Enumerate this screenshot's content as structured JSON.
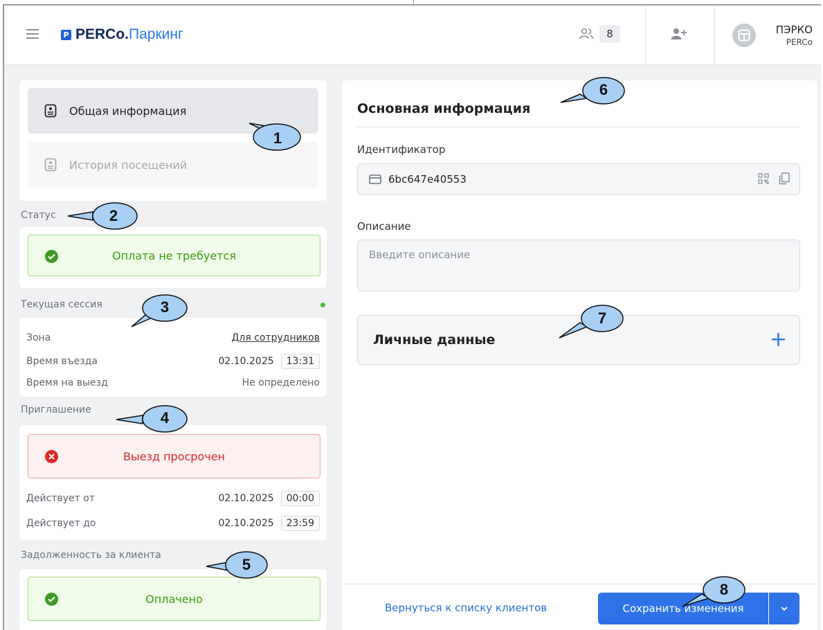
{
  "header": {
    "logo_mark": "P",
    "logo_brand": "PERCo.",
    "logo_app": "Паркинг",
    "users_count": "8",
    "user_name": "ПЭРКО",
    "user_org": "PERCo"
  },
  "nav": {
    "general_info": "Общая информация",
    "visit_history": "История посещений"
  },
  "status": {
    "label": "Статус",
    "text": "Оплата не требуется"
  },
  "session": {
    "label": "Текущая сессия",
    "zone_label": "Зона",
    "zone_value": "Для сотрудников",
    "entry_label": "Время въезда",
    "entry_date": "02.10.2025",
    "entry_time": "13:31",
    "exit_label": "Время на выезд",
    "exit_value": "Не определено"
  },
  "invitation": {
    "label": "Приглашение",
    "alert": "Выезд просрочен",
    "from_label": "Действует от",
    "from_date": "02.10.2025",
    "from_time": "00:00",
    "to_label": "Действует до",
    "to_date": "02.10.2025",
    "to_time": "23:59"
  },
  "debt": {
    "label": "Задолженность за клиента",
    "text": "Оплачено"
  },
  "main": {
    "title": "Основная информация",
    "id_label": "Идентификатор",
    "id_value": "6bc647e40553",
    "desc_label": "Описание",
    "desc_placeholder": "Введите описание",
    "personal_title": "Личные данные",
    "personal_plus": "+"
  },
  "footer": {
    "back": "Вернуться к списку клиентов",
    "save": "Сохранить изменения"
  },
  "callouts": [
    "1",
    "2",
    "3",
    "4",
    "5",
    "6",
    "7",
    "8"
  ],
  "colors": {
    "accent": "#2f72e8",
    "success": "#3f9a26",
    "error": "#d92b2b",
    "callout_fill": "#a8d0f5"
  },
  "icons": [
    "menu-icon",
    "users-icon",
    "add-user-icon",
    "avatar-icon",
    "profile-card-icon",
    "check-circle-icon",
    "error-circle-icon",
    "id-card-icon",
    "qr-code-icon",
    "copy-icon",
    "plus-icon",
    "chevron-down-icon"
  ]
}
